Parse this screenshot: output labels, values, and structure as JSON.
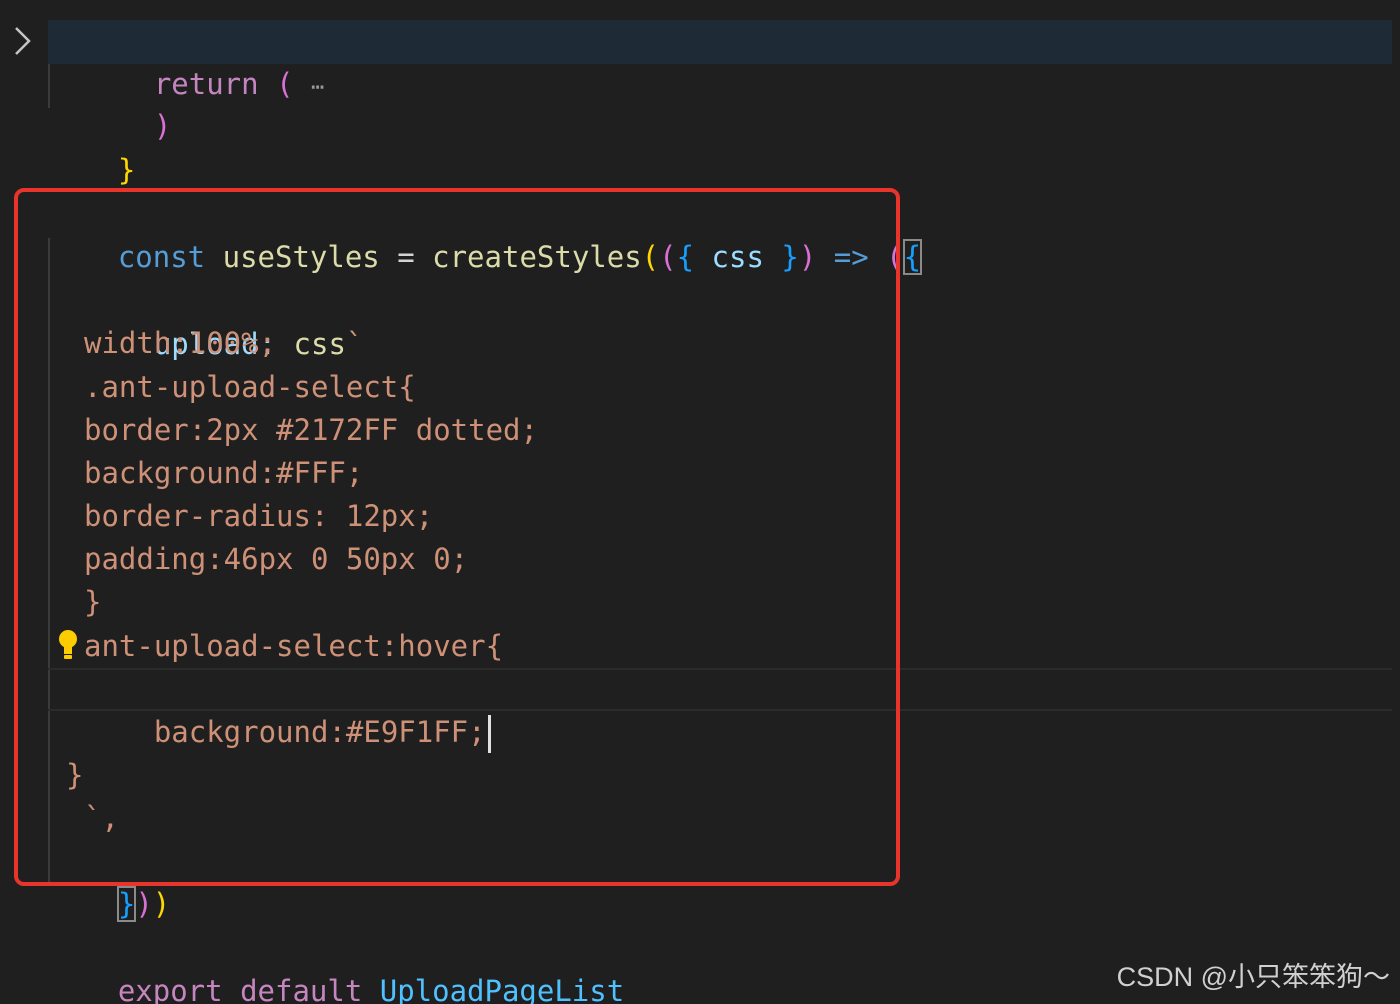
{
  "code": {
    "return_kw": "return",
    "return_paren": " (",
    "fold_ellipsis": "⋯",
    "close_paren": ")",
    "close_brace": "}",
    "const_kw": "const",
    "use_styles": " useStyles ",
    "equals": "= ",
    "create_styles": "createStyles",
    "open_paren1": "(",
    "open_paren2": "(",
    "open_brace1": "{",
    "css_param": " css ",
    "close_brace1": "}",
    "close_paren2": ")",
    "arrow": " => ",
    "open_paren3": "(",
    "open_brace2": "{",
    "upload_key": "upload:",
    "css_tag": " css",
    "backtick_open": "`",
    "lines": [
      "width:100%;",
      ".ant-upload-select{",
      "border:2px #2172FF dotted;",
      "background:#FFF;",
      "border-radius: 12px;",
      "padding:46px 0 50px 0;",
      "}",
      "ant-upload-select:hover{",
      "background:#E9F1FF;"
    ],
    "inner_close_brace": "}",
    "backtick_comma": "`,",
    "final_brace": "}",
    "final_paren1": ")",
    "final_paren2": ")",
    "export_kw": "export",
    "default_kw": " default ",
    "component_name": "UploadPageList"
  },
  "watermark": "CSDN @小只笨笨狗～",
  "icons": {
    "fold": "chevron-right-icon",
    "lightbulb": "lightbulb-icon"
  },
  "colors": {
    "background": "#1f1f1f",
    "highlight_border": "#e8342a",
    "string": "#ce9178",
    "keyword_purple": "#c586c0",
    "keyword_blue": "#569cd6",
    "function": "#dcdcaa",
    "variable": "#9cdcfe"
  }
}
